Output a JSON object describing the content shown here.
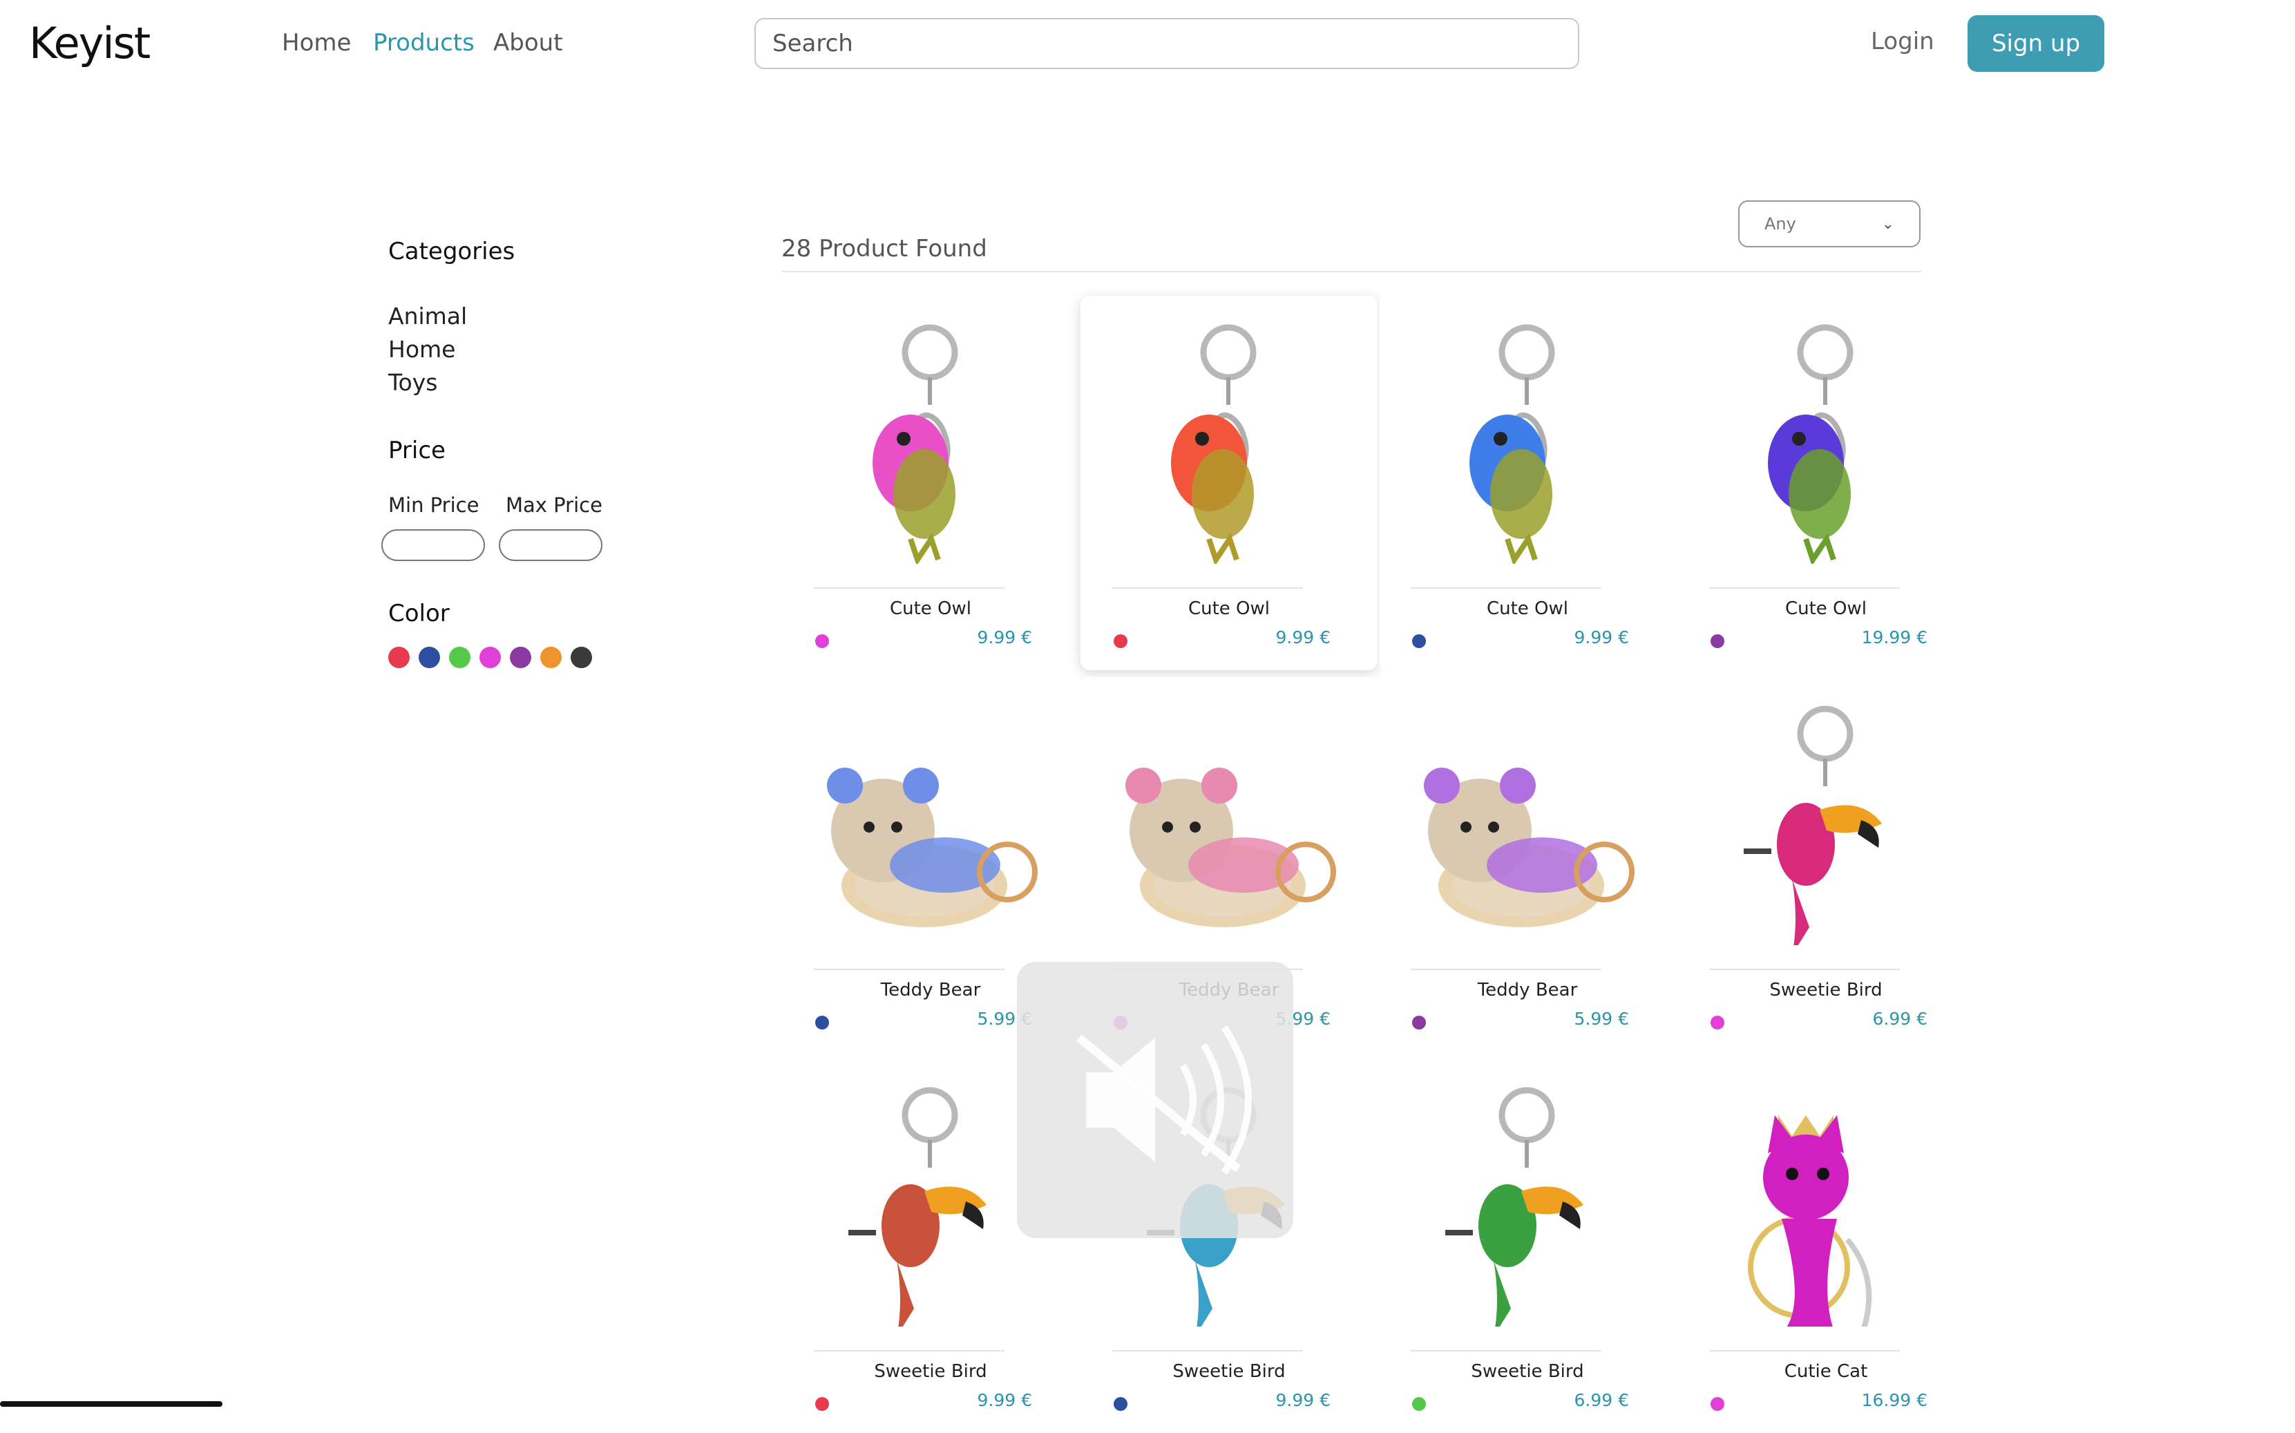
{
  "header": {
    "logo": "Keyist",
    "nav": [
      "Home",
      "Products",
      "About"
    ],
    "search_placeholder": "Search",
    "login": "Login",
    "signup": "Sign up"
  },
  "sidebar": {
    "categories_title": "Categories",
    "categories": [
      "Animal",
      "Home",
      "Toys"
    ],
    "price_title": "Price",
    "min_price_label": "Min Price",
    "max_price_label": "Max Price",
    "color_title": "Color",
    "colors": [
      "#e83a4f",
      "#2e4fa0",
      "#55c94a",
      "#e040d8",
      "#8a3aa0",
      "#f0922e",
      "#3a3a3a"
    ]
  },
  "results": {
    "count_text": "28 Product Found",
    "sort_value": "Any"
  },
  "products": [
    {
      "name": "Cute Owl",
      "price": "9.99 €",
      "color": "#e040d8",
      "body": "#e850c8",
      "wing": "#9aa02a"
    },
    {
      "name": "Cute Owl",
      "price": "9.99 €",
      "color": "#e83a4f",
      "body": "#f2553a",
      "wing": "#b09a2a"
    },
    {
      "name": "Cute Owl",
      "price": "9.99 €",
      "color": "#2e4fa0",
      "body": "#3f7ee8",
      "wing": "#9aa02a"
    },
    {
      "name": "Cute Owl",
      "price": "19.99 €",
      "color": "#8a3aa0",
      "body": "#5a3ad8",
      "wing": "#6aa02a"
    },
    {
      "name": "Teddy Bear",
      "price": "5.99 €",
      "color": "#2e4fa0",
      "body": "#d9c9b0",
      "wing": "#6f8ee8"
    },
    {
      "name": "Teddy Bear",
      "price": "5.99 €",
      "color": "#e040d8",
      "body": "#d9c9b0",
      "wing": "#e88ab0"
    },
    {
      "name": "Teddy Bear",
      "price": "5.99 €",
      "color": "#8a3aa0",
      "body": "#d9c9b0",
      "wing": "#b070e0"
    },
    {
      "name": "Sweetie Bird",
      "price": "6.99 €",
      "color": "#e040d8",
      "body": "#d82a7a",
      "wing": "#f0a020"
    },
    {
      "name": "Sweetie Bird",
      "price": "9.99 €",
      "color": "#e83a4f",
      "body": "#c8523a",
      "wing": "#f0a020"
    },
    {
      "name": "Sweetie Bird",
      "price": "9.99 €",
      "color": "#2e4fa0",
      "body": "#3aa0c8",
      "wing": "#f0a020"
    },
    {
      "name": "Sweetie Bird",
      "price": "6.99 €",
      "color": "#55c94a",
      "body": "#3aa040",
      "wing": "#f0a020"
    },
    {
      "name": "Cutie Cat",
      "price": "16.99 €",
      "color": "#e040d8",
      "body": "#d020c0",
      "wing": "#e0c060"
    }
  ]
}
